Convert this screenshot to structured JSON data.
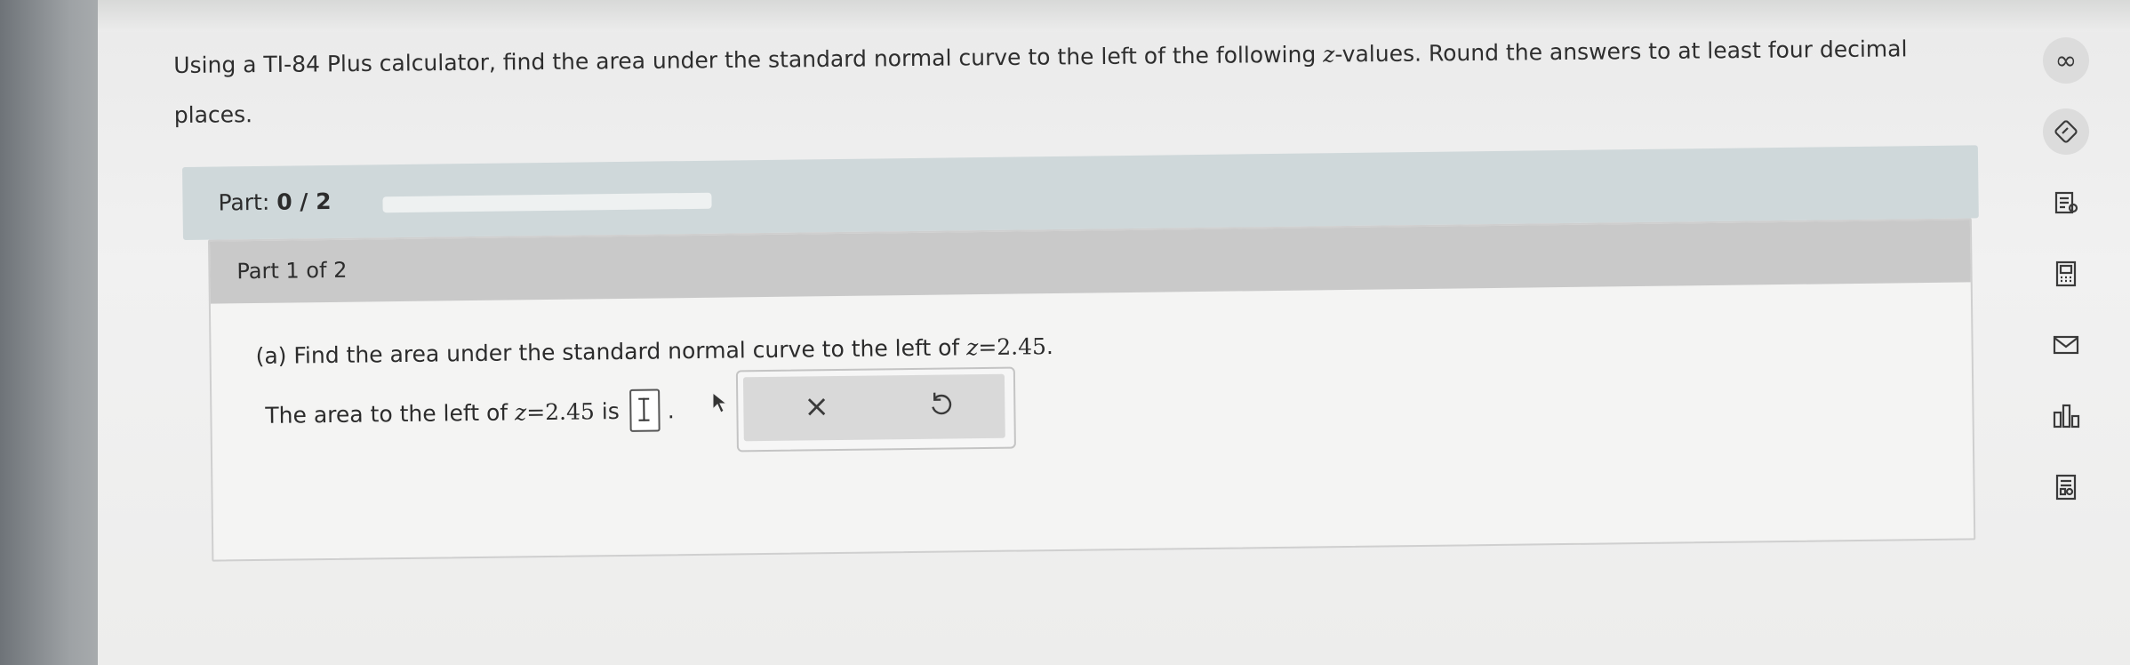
{
  "question": {
    "line1_pre": "Using a TI-84 Plus calculator, find the area under the standard normal curve to the left of the following ",
    "line1_var": "z",
    "line1_post": "-values. Round the answers to at least four decimal",
    "line2": "places."
  },
  "progress": {
    "label": "Part:",
    "value": "0 / 2",
    "fraction": 0
  },
  "part": {
    "header": "Part 1 of 2",
    "prompt_pre": "(a) Find the area under the standard normal curve to the left of ",
    "prompt_var": "z",
    "prompt_eq": "=2.45",
    "prompt_end": ".",
    "answer_pre": "The area to the left of ",
    "answer_var": "z",
    "answer_eq": "=2.45",
    "answer_is": " is",
    "answer_value": "",
    "answer_end": "."
  },
  "actions": {
    "clear_symbol": "×",
    "undo_icon": "undo-icon"
  },
  "toolbar": {
    "items": [
      {
        "name": "infinity-icon",
        "glyph": "∞"
      },
      {
        "name": "tag-icon"
      },
      {
        "name": "notes-icon"
      },
      {
        "name": "calculator-icon"
      },
      {
        "name": "mail-icon"
      },
      {
        "name": "chart-icon"
      },
      {
        "name": "worksheet-icon"
      }
    ]
  }
}
